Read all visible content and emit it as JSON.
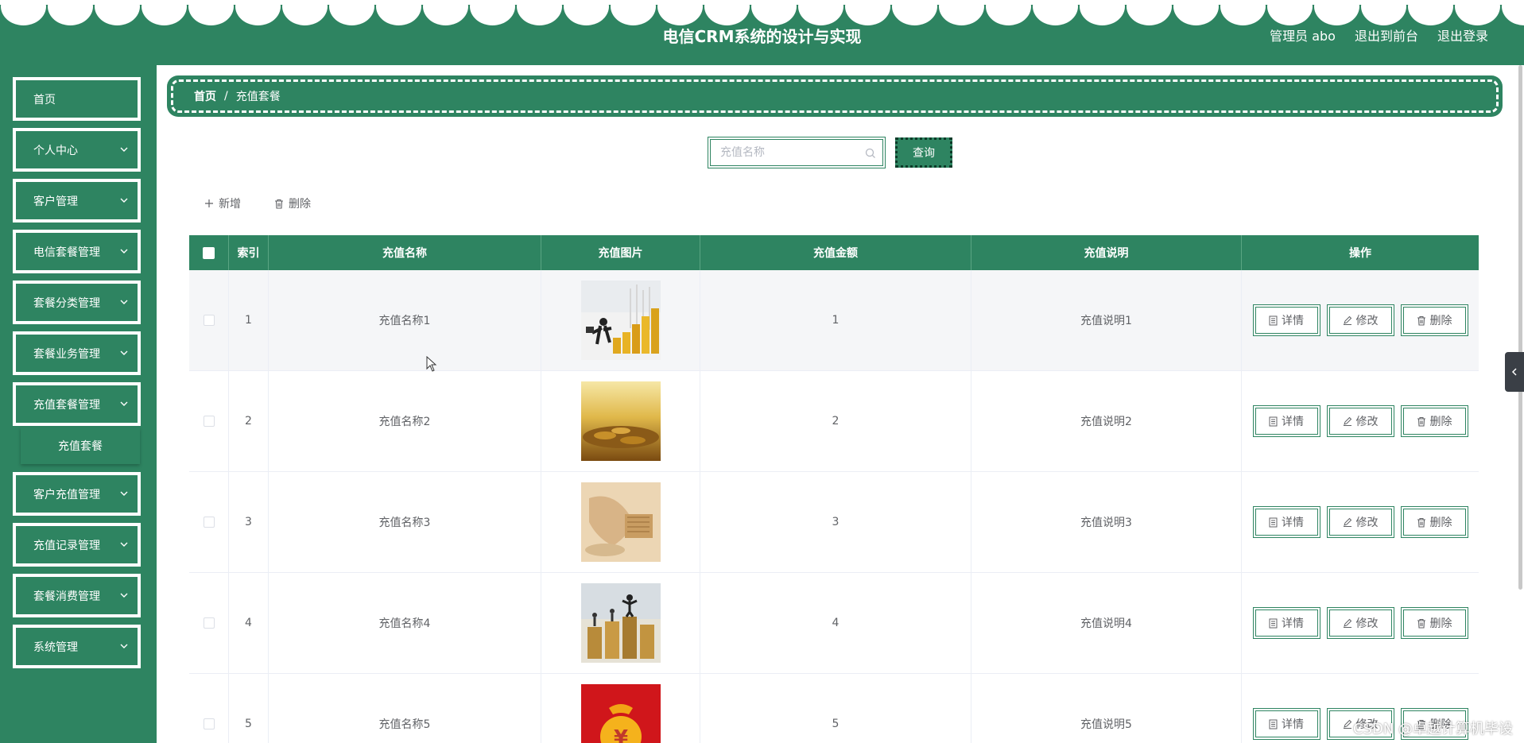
{
  "header": {
    "title": "电信CRM系统的设计与实现",
    "user_label": "管理员 abo",
    "front_label": "退出到前台",
    "logout_label": "退出登录"
  },
  "sidebar": {
    "items": [
      {
        "label": "首页"
      },
      {
        "label": "个人中心"
      },
      {
        "label": "客户管理"
      },
      {
        "label": "电信套餐管理"
      },
      {
        "label": "套餐分类管理"
      },
      {
        "label": "套餐业务管理"
      },
      {
        "label": "充值套餐管理"
      },
      {
        "label": "客户充值管理"
      },
      {
        "label": "充值记录管理"
      },
      {
        "label": "套餐消费管理"
      },
      {
        "label": "系统管理"
      }
    ],
    "active_sub": "充值套餐"
  },
  "breadcrumb": {
    "home": "首页",
    "separator": "/",
    "current": "充值套餐"
  },
  "search": {
    "placeholder": "充值名称",
    "value": "",
    "button": "查询"
  },
  "actions": {
    "add": "新增",
    "delete": "删除"
  },
  "table": {
    "headers": [
      "索引",
      "充值名称",
      "充值图片",
      "充值金额",
      "充值说明",
      "操作"
    ],
    "rows": [
      {
        "index": "1",
        "name": "充值名称1",
        "amount": "1",
        "desc": "充值说明1",
        "image": "businessman-stairs-coins"
      },
      {
        "index": "2",
        "name": "充值名称2",
        "amount": "2",
        "desc": "充值说明2",
        "image": "gold-coins-pile"
      },
      {
        "index": "3",
        "name": "充值名称3",
        "amount": "3",
        "desc": "充值说明3",
        "image": "money-hand-calculator"
      },
      {
        "index": "4",
        "name": "充值名称4",
        "amount": "4",
        "desc": "充值说明4",
        "image": "people-on-coin-stacks"
      },
      {
        "index": "5",
        "name": "充值名称5",
        "amount": "5",
        "desc": "充值说明5",
        "image": "red-money-bag"
      }
    ],
    "ops": {
      "detail": "详情",
      "edit": "修改",
      "delete": "删除"
    }
  },
  "watermark": "CSDN @卓越计算机毕设",
  "colors": {
    "primary": "#2e8461",
    "white": "#ffffff"
  }
}
